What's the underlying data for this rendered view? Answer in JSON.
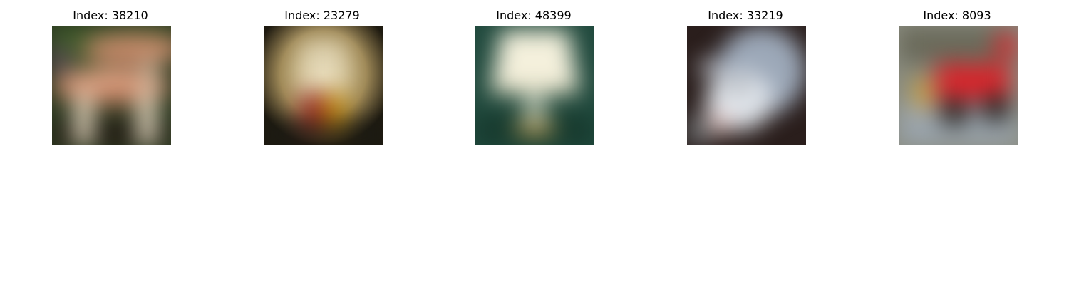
{
  "panels": [
    {
      "title": "Index: 38210",
      "subject": "mushroom-image"
    },
    {
      "title": "Index: 23279",
      "subject": "glass-image"
    },
    {
      "title": "Index: 48399",
      "subject": "lamp-image"
    },
    {
      "title": "Index: 33219",
      "subject": "opossum-image"
    },
    {
      "title": "Index: 8093",
      "subject": "tractor-image"
    }
  ]
}
